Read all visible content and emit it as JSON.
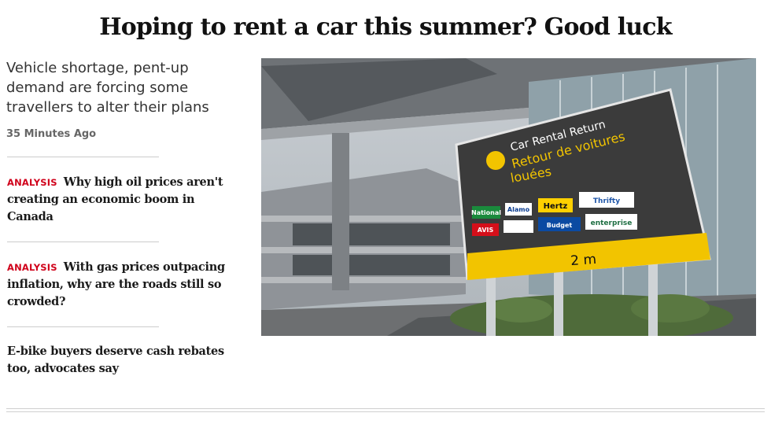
{
  "article": {
    "headline": "Hoping to rent a car this summer? Good luck",
    "dek": "Vehicle shortage, pent-up demand are forcing some travellers to alter their plans",
    "timestamp": "35 Minutes Ago"
  },
  "related": [
    {
      "tag": "ANALYSIS",
      "title": "Why high oil prices aren't creating an economic boom in Canada"
    },
    {
      "tag": "ANALYSIS",
      "title": "With gas prices outpacing inflation, why are the roads still so crowded?"
    },
    {
      "tag": "",
      "title": "E-bike buyers deserve cash rebates too, advocates say"
    }
  ],
  "photo": {
    "sign": {
      "line1": "Car Rental Return",
      "line2": "Retour de voitures",
      "line3": "louées",
      "clearance": "2 m",
      "brands": [
        "National",
        "Alamo",
        "Hertz",
        "Thrifty",
        "AVIS",
        "Budget",
        "enterprise"
      ]
    }
  },
  "colors": {
    "tag": "#d0021b",
    "sign_bg": "#3b3b3b",
    "sign_yellow": "#f2c400"
  }
}
